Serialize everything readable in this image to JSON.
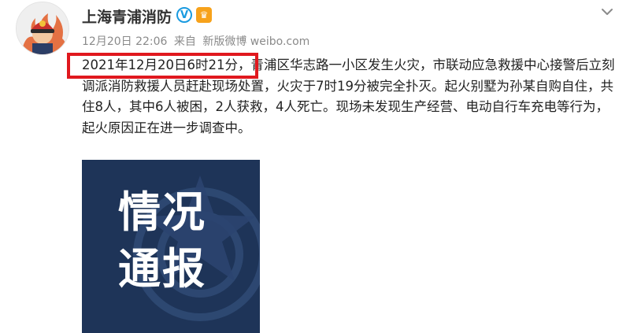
{
  "account": {
    "name": "上海青浦消防",
    "verified_icon": "verified-v-icon",
    "vip_icon": "crown-badge-icon"
  },
  "meta": {
    "date": "12月20日 22:06",
    "source_prefix": "来自",
    "source": "新版微博 weibo.com"
  },
  "post": {
    "highlighted_text": "2021年12月20日6时21分，",
    "body_text": "青浦区华志路一小区发生火灾，市联动应急救援中心接警后立刻调派消防救援人员赶赴现场处置，火灾于7时19分被完全扑灭。起火别墅为孙某自购自住，共住8人，其中6人被困，2人获救，4人死亡。现场未发现生产经营、电动自行车充电等行为，起火原因正在进一步调查中。"
  },
  "image": {
    "line1": "情况",
    "line2": "通报"
  },
  "colors": {
    "highlight": "#e0181e",
    "card_bg": "#1e3458",
    "verified": "#1a9be0",
    "vip": "#f7a21b"
  }
}
